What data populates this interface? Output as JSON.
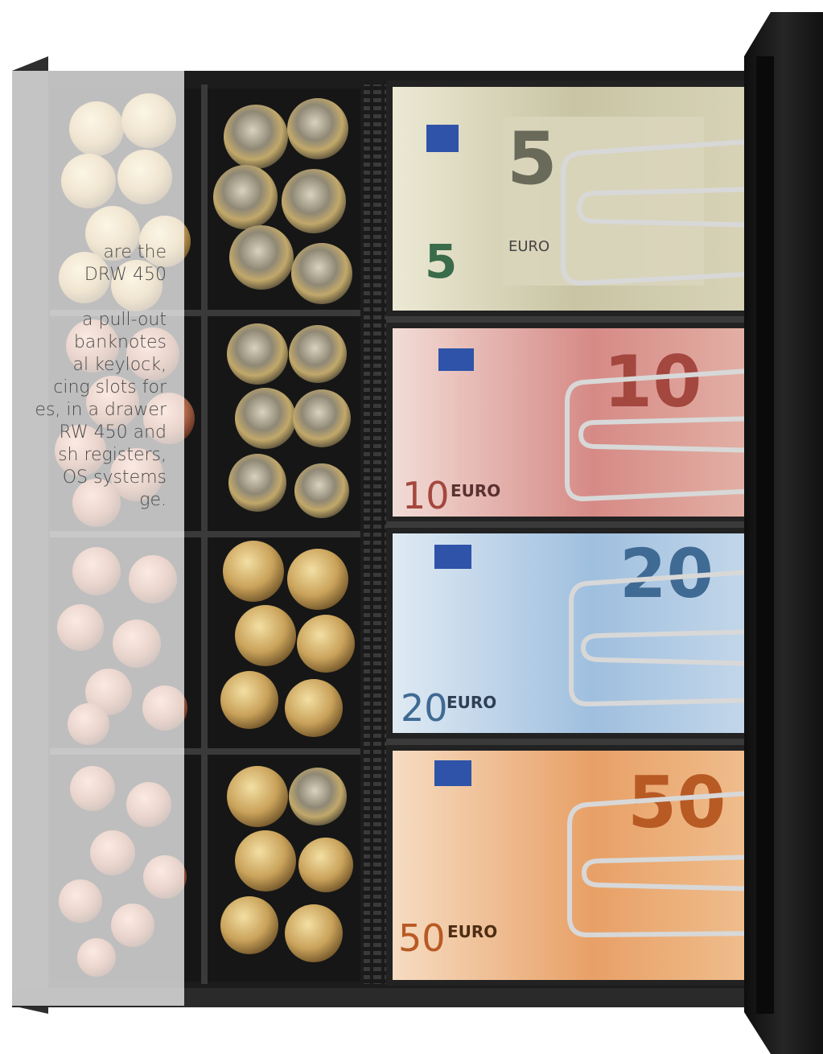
{
  "photo": {
    "subject": "cash drawer insert with euro coins and banknotes",
    "banknote_rows": [
      {
        "denomination": "5",
        "currency_label": "EURO",
        "color": "#c8c4a4"
      },
      {
        "denomination": "10",
        "currency_label": "EURO",
        "color": "#d68a86"
      },
      {
        "denomination": "20",
        "currency_label": "EURO",
        "color": "#9fbfdf"
      },
      {
        "denomination": "50",
        "currency_label": "EURO",
        "color": "#e8a066"
      }
    ],
    "colors": {
      "drawer": "#1c1c1c",
      "drawer_edge": "#2e2e2e",
      "divider": "#3a3a3a",
      "coin_gold": "#c9a25a",
      "coin_copper": "#b36a4c",
      "coin_bimetal": "#7a7466",
      "clip_wire": "#d8d8d8"
    }
  },
  "text": {
    "para1": [
      "are the",
      "DRW 450"
    ],
    "para2": [
      "a pull-out",
      "banknotes",
      "al keylock,",
      "cing slots for",
      "es, in a drawer",
      "RW 450 and",
      "sh registers,",
      "OS systems",
      "ge."
    ]
  }
}
